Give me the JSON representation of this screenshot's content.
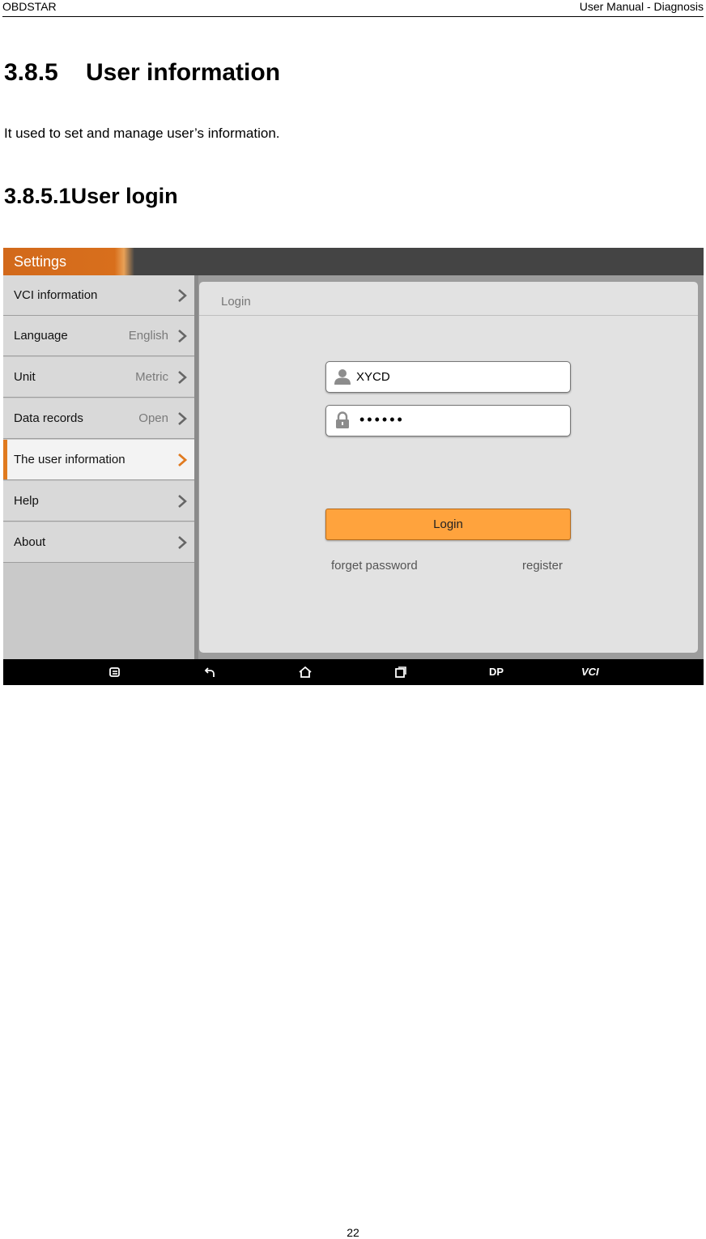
{
  "header": {
    "brand": "OBDSTAR",
    "section": "User Manual - Diagnosis"
  },
  "heading1": {
    "number": "3.8.5",
    "title": "User information"
  },
  "intro": "It used to set and manage user’s information.",
  "heading2": "3.8.5.1User login",
  "screenshot": {
    "tab_title": "Settings",
    "menu": [
      {
        "label": "VCI information",
        "value": ""
      },
      {
        "label": "Language",
        "value": "English"
      },
      {
        "label": "Unit",
        "value": "Metric"
      },
      {
        "label": "Data records",
        "value": "Open"
      },
      {
        "label": "The user information",
        "value": ""
      },
      {
        "label": "Help",
        "value": ""
      },
      {
        "label": "About",
        "value": ""
      }
    ],
    "active_item": "The user information",
    "panel_title": "Login",
    "username_value": "XYCD",
    "password_value": "••••••",
    "login_button": "Login",
    "forget_link": "forget password",
    "register_link": "register",
    "nav": {
      "dp_label": "DP",
      "vci_label": "VCI"
    },
    "colors": {
      "accent": "#e07a1f",
      "button": "#ffa33d"
    },
    "icons": [
      "user-icon",
      "lock-icon",
      "chevron-right-icon",
      "screenshot-icon",
      "back-icon",
      "home-icon",
      "recent-apps-icon"
    ]
  },
  "page_number": "22"
}
